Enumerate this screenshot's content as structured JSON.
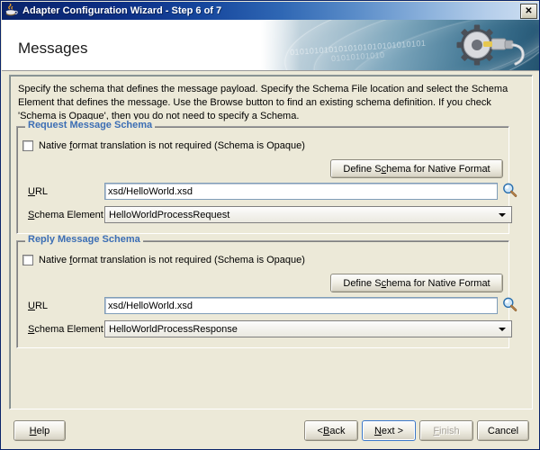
{
  "window": {
    "title": "Adapter Configuration Wizard - Step 6 of 7",
    "icon": "java-coffee-cup-icon",
    "close_label": "✕"
  },
  "banner": {
    "title": "Messages",
    "art_binary_1": "0101010101010101010101010101",
    "art_binary_2": "01010101010",
    "art_icon": "gear-with-cable-icon"
  },
  "content": {
    "description": "Specify the schema that defines the message payload.  Specify the Schema File location and select the Schema Element that defines the message. Use the Browse button to find an existing schema definition. If you check 'Schema is Opaque', then you do not need to specify a Schema."
  },
  "request_group": {
    "title": "Request Message Schema",
    "checkbox_label_pre": "Native ",
    "checkbox_mnemonic": "f",
    "checkbox_label_post": "ormat translation is not required (Schema is Opaque)",
    "checkbox_checked": false,
    "native_button_pre": "Define S",
    "native_button_mnemonic": "c",
    "native_button_post": "hema for Native Format",
    "url_label_mnemonic": "U",
    "url_label_post": "RL",
    "url_value": "xsd/HelloWorld.xsd",
    "browse_icon": "magnifier-icon",
    "element_label_mnemonic": "S",
    "element_label_post": "chema Element",
    "element_value": "HelloWorldProcessRequest"
  },
  "reply_group": {
    "title": "Reply Message Schema",
    "checkbox_label_pre": "Native ",
    "checkbox_mnemonic": "f",
    "checkbox_label_post": "ormat translation is not required (Schema is Opaque)",
    "checkbox_checked": false,
    "native_button_pre": "Define S",
    "native_button_mnemonic": "c",
    "native_button_post": "hema for Native Format",
    "url_label_mnemonic": "U",
    "url_label_post": "RL",
    "url_value": "xsd/HelloWorld.xsd",
    "browse_icon": "magnifier-icon",
    "element_label_mnemonic": "S",
    "element_label_post": "chema Element",
    "element_value": "HelloWorldProcessResponse"
  },
  "footer": {
    "help_mnemonic": "H",
    "help_pre": "",
    "help_post": "elp",
    "back_pre": "< ",
    "back_mnemonic": "B",
    "back_post": "ack",
    "next_mnemonic": "N",
    "next_post": "ext >",
    "finish_pre": "",
    "finish_mnemonic": "F",
    "finish_post": "inish",
    "finish_enabled": false,
    "cancel_label": "Cancel"
  },
  "colors": {
    "group_title": "#3c6eb4",
    "titlebar_start": "#0a246a",
    "dialog_face": "#ece9d8",
    "focus_border": "#3c78c8"
  }
}
